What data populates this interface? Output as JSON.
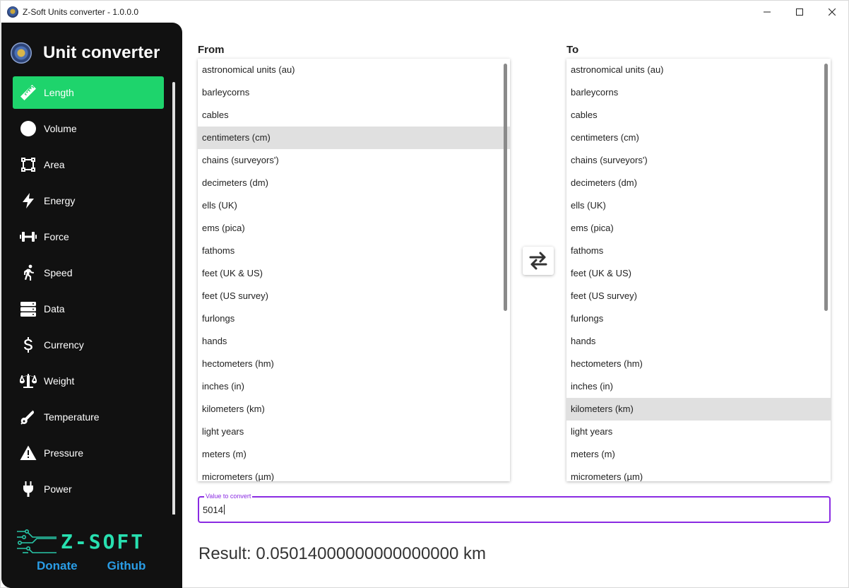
{
  "window": {
    "title": "Z-Soft Units converter - 1.0.0.0",
    "controls": {
      "minimize": "—",
      "maximize": "☐",
      "close": "✕"
    }
  },
  "sidebar": {
    "title": "Unit converter",
    "items": [
      {
        "label": "Length",
        "icon": "ruler-icon",
        "active": true
      },
      {
        "label": "Volume",
        "icon": "circle-icon"
      },
      {
        "label": "Area",
        "icon": "vector-square-icon"
      },
      {
        "label": "Energy",
        "icon": "lightning-icon"
      },
      {
        "label": "Force",
        "icon": "dumbbell-icon"
      },
      {
        "label": "Speed",
        "icon": "running-icon"
      },
      {
        "label": "Data",
        "icon": "server-icon"
      },
      {
        "label": "Currency",
        "icon": "dollar-icon"
      },
      {
        "label": "Weight",
        "icon": "scale-icon"
      },
      {
        "label": "Temperature",
        "icon": "thermometer-icon"
      },
      {
        "label": "Pressure",
        "icon": "warning-icon"
      },
      {
        "label": "Power",
        "icon": "plug-icon"
      }
    ],
    "footer": {
      "brand": "Z-SOFT",
      "donate": "Donate",
      "github": "Github"
    }
  },
  "converter": {
    "from_label": "From",
    "to_label": "To",
    "from_items": [
      "astronomical units (au)",
      "barleycorns",
      "cables",
      "centimeters (cm)",
      "chains (surveyors')",
      "decimeters (dm)",
      "ells (UK)",
      "ems (pica)",
      "fathoms",
      "feet (UK & US)",
      "feet (US survey)",
      "furlongs",
      "hands",
      "hectometers (hm)",
      "inches (in)",
      "kilometers (km)",
      "light years",
      "meters (m)",
      "micrometers (µm)"
    ],
    "from_selected": 3,
    "to_items": [
      "astronomical units (au)",
      "barleycorns",
      "cables",
      "centimeters (cm)",
      "chains (surveyors')",
      "decimeters (dm)",
      "ells (UK)",
      "ems (pica)",
      "fathoms",
      "feet (UK & US)",
      "feet (US survey)",
      "furlongs",
      "hands",
      "hectometers (hm)",
      "inches (in)",
      "kilometers (km)",
      "light years",
      "meters (m)",
      "micrometers (µm)"
    ],
    "to_selected": 15,
    "swap_icon": "swap-arrows-icon",
    "input_label": "Value to convert",
    "input_value": "5014",
    "result": "Result: 0.05014000000000000000 km"
  },
  "colors": {
    "accent": "#1ed46c",
    "focus": "#8a2be2",
    "link": "#2a9de6",
    "sidebar_bg": "#111111"
  }
}
